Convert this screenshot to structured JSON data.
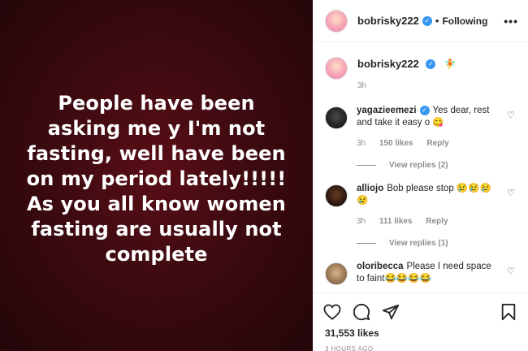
{
  "post_image": {
    "text": "People have been\nasking me y I'm not\nfasting, well have been\non my period lately!!!!!\nAs you all know women\nfasting are usually not\ncomplete"
  },
  "header": {
    "username": "bobrisky222",
    "separator": "•",
    "follow_status": "Following",
    "more": "•••"
  },
  "caption": {
    "username": "bobrisky222",
    "emoji": "🧚",
    "time": "3h"
  },
  "comments": [
    {
      "username": "yagazieemezi",
      "verified": true,
      "text": "Yes dear, rest and take it easy o 😋",
      "time": "3h",
      "likes": "150 likes",
      "reply": "Reply",
      "view_replies": "View replies (2)"
    },
    {
      "username": "alliojo",
      "verified": false,
      "text": "Bob please stop 😢😢😢 😢",
      "time": "3h",
      "likes": "111 likes",
      "reply": "Reply",
      "view_replies": "View replies (1)"
    },
    {
      "username": "oloribecca",
      "verified": false,
      "text": "Please I need space to faint😂😂😂😂",
      "time": "",
      "likes": "",
      "reply": "",
      "view_replies": ""
    }
  ],
  "likes_count": "31,553 likes",
  "post_time": "3 HOURS AGO",
  "colors": {
    "image_bg": "#3c0a10",
    "verified_blue": "#3897f0",
    "muted": "#8e8e8e"
  }
}
